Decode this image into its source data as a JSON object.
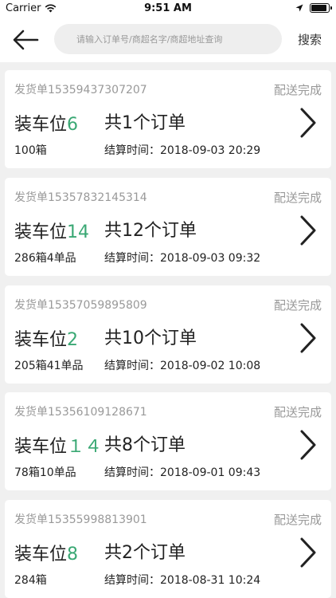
{
  "status_bar": {
    "carrier": "Carrier",
    "time": "9:51 AM"
  },
  "nav": {
    "search_placeholder": "请输入订单号/商超名字/商超地址查询",
    "search_label": "搜索"
  },
  "orders": [
    {
      "shipment_no": "发货单15359437307207",
      "status": "配送完成",
      "bay_label": "装车位",
      "bay_number": "6",
      "order_count": "共1个订单",
      "quantity": "100箱",
      "settle_label": "结算时间：",
      "settle_time": "2018-09-03 20:29"
    },
    {
      "shipment_no": "发货单15357832145314",
      "status": "配送完成",
      "bay_label": "装车位",
      "bay_number": "14",
      "order_count": "共12个订单",
      "quantity": "286箱4单品",
      "settle_label": "结算时间：",
      "settle_time": "2018-09-03 09:32"
    },
    {
      "shipment_no": "发货单15357059895809",
      "status": "配送完成",
      "bay_label": "装车位",
      "bay_number": "2",
      "order_count": "共10个订单",
      "quantity": "205箱41单品",
      "settle_label": "结算时间：",
      "settle_time": "2018-09-02 10:08"
    },
    {
      "shipment_no": "发货单15356109128671",
      "status": "配送完成",
      "bay_label": "装车位",
      "bay_number": "１４",
      "order_count": "共8个订单",
      "quantity": "78箱10单品",
      "settle_label": "结算时间：",
      "settle_time": "2018-09-01 09:43"
    },
    {
      "shipment_no": "发货单15355998813901",
      "status": "配送完成",
      "bay_label": "装车位",
      "bay_number": "8",
      "order_count": "共2个订单",
      "quantity": "284箱",
      "settle_label": "结算时间：",
      "settle_time": "2018-08-31 10:24"
    }
  ],
  "colors": {
    "accent": "#3aa874",
    "muted": "#999999",
    "background": "#f0f0f0"
  },
  "icons": {
    "back": "arrow-left-icon",
    "chevron": "chevron-right-icon",
    "wifi": "wifi-icon",
    "location": "location-arrow-icon",
    "battery": "battery-icon"
  },
  "battery_level": 0.9
}
